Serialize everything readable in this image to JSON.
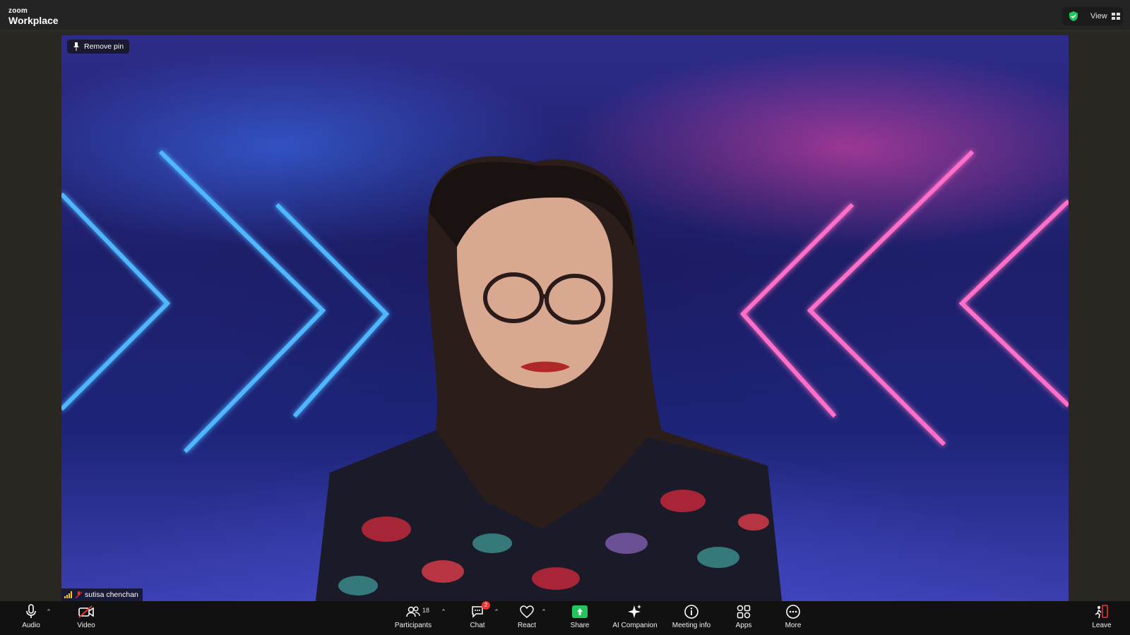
{
  "app": {
    "logo_top": "zoom",
    "logo_bottom": "Workplace"
  },
  "header": {
    "view_label": "View"
  },
  "video": {
    "pin_label": "Remove pin",
    "participant_name": "sutisa chenchan"
  },
  "toolbar": {
    "audio": "Audio",
    "video": "Video",
    "participants": "Participants",
    "participants_count": "18",
    "chat": "Chat",
    "chat_badge": "2",
    "react": "React",
    "share": "Share",
    "ai_companion": "AI Companion",
    "meeting_info": "Meeting info",
    "apps": "Apps",
    "more": "More",
    "leave": "Leave"
  },
  "icons": {
    "shield": "shield-check-icon",
    "view": "grid-view-icon",
    "pin": "pin-icon",
    "audio": "microphone-icon",
    "video": "video-off-icon",
    "participants": "people-icon",
    "chat": "chat-bubble-icon",
    "react": "heart-icon",
    "share": "share-screen-icon",
    "ai": "sparkle-icon",
    "info": "info-icon",
    "apps": "apps-icon",
    "more": "more-icon",
    "leave": "leave-icon"
  },
  "colors": {
    "share_green": "#22c55e",
    "shield_green": "#22c55e",
    "badge_red": "#e53935",
    "leave_red": "#e53935",
    "neon_blue": "#4fb7ff",
    "neon_pink": "#ff6ec7"
  }
}
